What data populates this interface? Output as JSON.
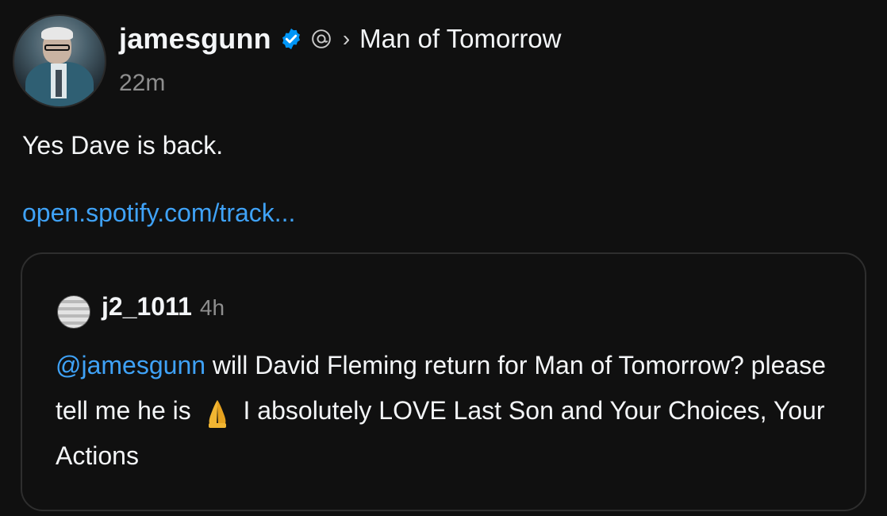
{
  "post": {
    "author": "jamesgunn",
    "topic": "Man of Tomorrow",
    "time": "22m",
    "text": "Yes Dave is back.",
    "link": "open.spotify.com/track..."
  },
  "quoted": {
    "author": "j2_1011",
    "time": "4h",
    "mention": "@jamesgunn",
    "text_part1": " will David Fleming return for Man of Tomorrow? please tell me he is ",
    "emoji": "folded-hands-emoji",
    "text_part2": " I absolutely LOVE Last Son and Your Choices, Your Actions"
  },
  "colors": {
    "background": "#101010",
    "link": "#3fa2f7",
    "verified": "#0095f6",
    "muted": "#8e8e8e"
  },
  "icons": {
    "verified": "verified-badge-icon",
    "threads": "threads-icon",
    "chevron": "chevron-right-icon"
  }
}
